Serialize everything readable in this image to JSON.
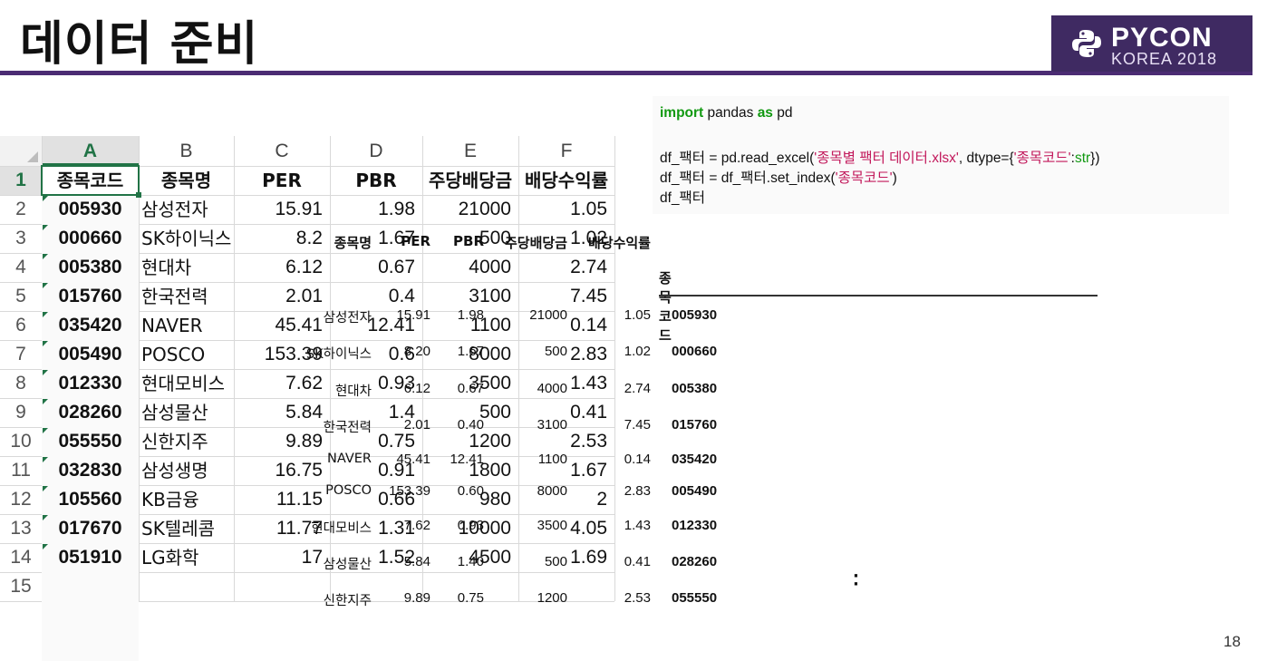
{
  "slide": {
    "title": "데이터 준비",
    "page_number": "18",
    "logo": {
      "brand": "PYCON",
      "sub": "KOREA 2018"
    },
    "colors": {
      "accent": "#4b2c73",
      "excel_green": "#217346"
    }
  },
  "spreadsheet": {
    "column_letters": [
      "A",
      "B",
      "C",
      "D",
      "E",
      "F"
    ],
    "row_numbers": [
      "1",
      "2",
      "3",
      "4",
      "5",
      "6",
      "7",
      "8",
      "9",
      "10",
      "11",
      "12",
      "13",
      "14",
      "15"
    ],
    "headers": [
      "종목코드",
      "종목명",
      "PER",
      "PBR",
      "주당배당금",
      "배당수익률"
    ],
    "rows": [
      [
        "005930",
        "삼성전자",
        "15.91",
        "1.98",
        "21000",
        "1.05"
      ],
      [
        "000660",
        "SK하이닉스",
        "8.2",
        "1.67",
        "500",
        "1.02"
      ],
      [
        "005380",
        "현대차",
        "6.12",
        "0.67",
        "4000",
        "2.74"
      ],
      [
        "015760",
        "한국전력",
        "2.01",
        "0.4",
        "3100",
        "7.45"
      ],
      [
        "035420",
        "NAVER",
        "45.41",
        "12.41",
        "1100",
        "0.14"
      ],
      [
        "005490",
        "POSCO",
        "153.39",
        "0.6",
        "8000",
        "2.83"
      ],
      [
        "012330",
        "현대모비스",
        "7.62",
        "0.93",
        "3500",
        "1.43"
      ],
      [
        "028260",
        "삼성물산",
        "5.84",
        "1.4",
        "500",
        "0.41"
      ],
      [
        "055550",
        "신한지주",
        "9.89",
        "0.75",
        "1200",
        "2.53"
      ],
      [
        "032830",
        "삼성생명",
        "16.75",
        "0.91",
        "1800",
        "1.67"
      ],
      [
        "105560",
        "KB금융",
        "11.15",
        "0.66",
        "980",
        "2"
      ],
      [
        "017670",
        "SK텔레콤",
        "11.77",
        "1.31",
        "10000",
        "4.05"
      ],
      [
        "051910",
        "LG화학",
        "17",
        "1.52",
        "4500",
        "1.69"
      ]
    ]
  },
  "code": {
    "line1": {
      "kw_import": "import",
      "a": " pandas ",
      "kw_as": "as",
      "b": " pd"
    },
    "line2": {
      "a": "df_팩터 = pd.read_excel(",
      "s1": "'종목별 팩터 데이터.xlsx'",
      "b": ", dtype={",
      "s2": "'종목코드'",
      "c": ":",
      "d": "str",
      "e": "})"
    },
    "line3": {
      "a": "df_팩터 = df_팩터.set_index(",
      "s1": "'종목코드'",
      "b": ")"
    },
    "line4": "df_팩터"
  },
  "dataframe": {
    "columns": [
      "종목명",
      "PER",
      "PBR",
      "주당배당금",
      "배당수익률"
    ],
    "index_name": "종목코드",
    "rows": [
      [
        "005930",
        "삼성전자",
        "15.91",
        "1.98",
        "21000",
        "1.05"
      ],
      [
        "000660",
        "SK하이닉스",
        "8.20",
        "1.67",
        "500",
        "1.02"
      ],
      [
        "005380",
        "현대차",
        "6.12",
        "0.67",
        "4000",
        "2.74"
      ],
      [
        "015760",
        "한국전력",
        "2.01",
        "0.40",
        "3100",
        "7.45"
      ],
      [
        "035420",
        "NAVER",
        "45.41",
        "12.41",
        "1100",
        "0.14"
      ],
      [
        "005490",
        "POSCO",
        "153.39",
        "0.60",
        "8000",
        "2.83"
      ],
      [
        "012330",
        "현대모비스",
        "7.62",
        "0.93",
        "3500",
        "1.43"
      ],
      [
        "028260",
        "삼성물산",
        "5.84",
        "1.40",
        "500",
        "0.41"
      ],
      [
        "055550",
        "신한지주",
        "9.89",
        "0.75",
        "1200",
        "2.53"
      ]
    ]
  }
}
